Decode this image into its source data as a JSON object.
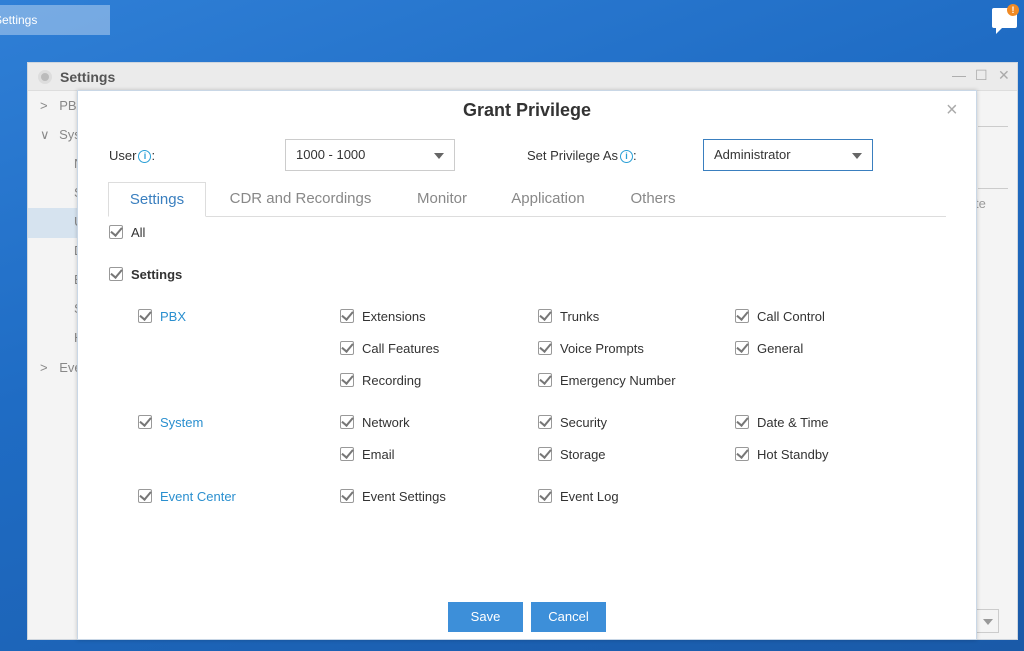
{
  "taskbar": {
    "window_label": "Settings"
  },
  "notification": {
    "badge": "!"
  },
  "settings_window": {
    "title": "Settings",
    "controls": {
      "minimize": "—",
      "maximize": "☐",
      "close": "✕"
    },
    "sidebar": [
      {
        "label": "PBX",
        "expander": ">"
      },
      {
        "label": "System",
        "expander": "∨"
      },
      {
        "label": "N"
      },
      {
        "label": "S"
      },
      {
        "label": "U"
      },
      {
        "label": "D"
      },
      {
        "label": "E"
      },
      {
        "label": "S"
      },
      {
        "label": "H"
      },
      {
        "label": "Event Center",
        "expander": ">"
      }
    ],
    "right_fragment": "te"
  },
  "dialog": {
    "title": "Grant Privilege",
    "close": "×",
    "user_label": "User",
    "user_value": "1000 - 1000",
    "privilege_label": "Set Privilege As",
    "privilege_value": "Administrator",
    "tabs": [
      "Settings",
      "CDR and Recordings",
      "Monitor",
      "Application",
      "Others"
    ],
    "all_label": "All",
    "section_label": "Settings",
    "groups": [
      {
        "name": "PBX",
        "items": [
          "Extensions",
          "Trunks",
          "Call Control",
          "Call Features",
          "Voice Prompts",
          "General",
          "Recording",
          "Emergency Number"
        ]
      },
      {
        "name": "System",
        "items": [
          "Network",
          "Security",
          "Date & Time",
          "Email",
          "Storage",
          "Hot Standby"
        ]
      },
      {
        "name": "Event Center",
        "items": [
          "Event Settings",
          "Event Log"
        ]
      }
    ],
    "save": "Save",
    "cancel": "Cancel"
  },
  "colors": {
    "accent": "#3d8fd9",
    "link": "#2a8fcf",
    "desktop": "#1f6cc4"
  }
}
